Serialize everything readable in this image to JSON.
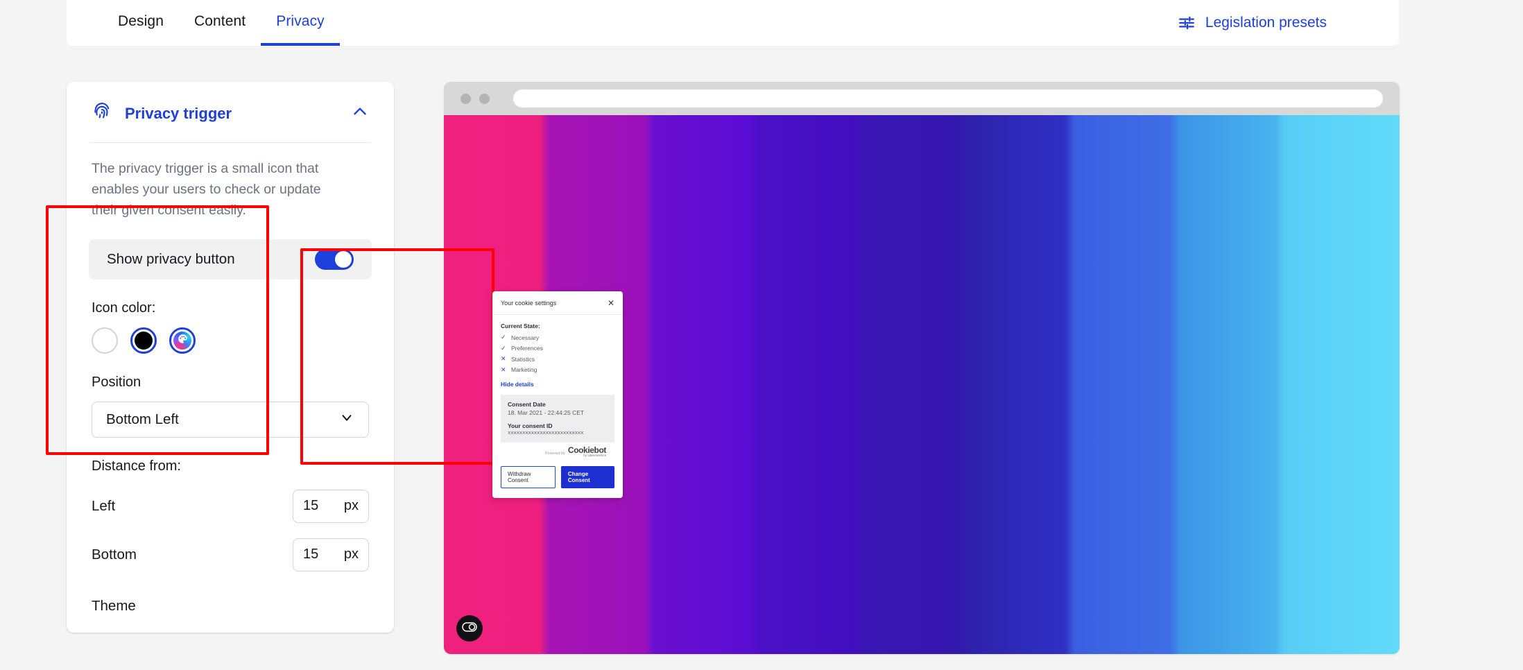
{
  "topbar": {
    "tabs": [
      {
        "label": "Design",
        "active": false
      },
      {
        "label": "Content",
        "active": false
      },
      {
        "label": "Privacy",
        "active": true
      }
    ],
    "legislation_label": "Legislation presets",
    "legislation_icon": "sliders-icon",
    "accent_color": "#1d3fdb"
  },
  "panel": {
    "icon": "fingerprint-icon",
    "title": "Privacy trigger",
    "collapse_icon": "chevron-up-icon",
    "description": "The privacy trigger is a small icon that enables your users to check or update their given consent easily.",
    "show_privacy": {
      "label": "Show privacy button",
      "toggle_on": true
    },
    "icon_color": {
      "label": "Icon color:",
      "options": [
        {
          "name": "white",
          "value": "#ffffff",
          "selected": false
        },
        {
          "name": "black",
          "value": "#000000",
          "selected": true
        },
        {
          "name": "custom-palette",
          "value": "gradient",
          "selected": true,
          "icon": "palette-icon"
        }
      ]
    },
    "position": {
      "label": "Position",
      "value": "Bottom Left",
      "chevron": "chevron-down-icon"
    },
    "distance": {
      "label": "Distance from:",
      "rows": [
        {
          "label": "Left",
          "value": "15",
          "unit": "px"
        },
        {
          "label": "Bottom",
          "value": "15",
          "unit": "px"
        }
      ]
    },
    "theme_label": "Theme"
  },
  "preview": {
    "browser_dots": 2,
    "url_value": "",
    "gradient_colors": [
      "#f0207f",
      "#a814b4",
      "#6a0fcf",
      "#4b10c6",
      "#3a17b4",
      "#2e21ab",
      "#3a5fe0",
      "#3b94e6",
      "#57cdf5"
    ],
    "trigger_badge_icon": "cookie-toggle-icon",
    "dialog": {
      "title": "Your cookie settings",
      "close_icon": "close-icon",
      "state_label": "Current State:",
      "items": [
        {
          "label": "Necessary",
          "state": "checked",
          "mark": "✓"
        },
        {
          "label": "Preferences",
          "state": "checked",
          "mark": "✓"
        },
        {
          "label": "Statistics",
          "state": "unchecked",
          "mark": "✕"
        },
        {
          "label": "Marketing",
          "state": "unchecked",
          "mark": "✕"
        }
      ],
      "hide_details": "Hide details",
      "consent_date_label": "Consent Date",
      "consent_date_value": "18. Mar 2021 - 22:44:25 CET",
      "consent_id_label": "Your consent ID",
      "consent_id_value": "xxxxxxxxxxxxxxxxxxxxxxxxxx",
      "powered_by": "Powered by",
      "brand": "Cookiebot",
      "brand_sub": "by Usercentrics",
      "withdraw_label": "Withdraw Consent",
      "change_label": "Change Consent"
    }
  }
}
